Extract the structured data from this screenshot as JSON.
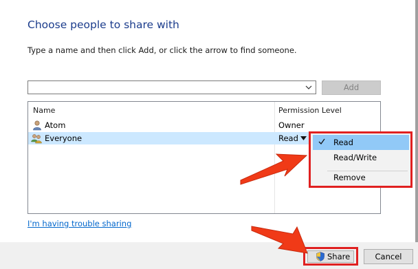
{
  "header": {
    "title": "Choose people to share with",
    "instruction": "Type a name and then click Add, or click the arrow to find someone."
  },
  "name_input": {
    "value": ""
  },
  "add_button": {
    "label": "Add",
    "enabled": false
  },
  "list": {
    "columns": [
      "Name",
      "Permission Level"
    ],
    "rows": [
      {
        "name": "Atom",
        "permission": "Owner",
        "icon": "user-icon",
        "selected": false
      },
      {
        "name": "Everyone",
        "permission": "Read",
        "icon": "users-group-icon",
        "selected": true
      }
    ]
  },
  "permission_menu": {
    "items": [
      {
        "label": "Read",
        "checked": true,
        "highlighted": true
      },
      {
        "label": "Read/Write",
        "checked": false,
        "highlighted": false
      },
      {
        "label": "Remove",
        "checked": false,
        "highlighted": false
      }
    ]
  },
  "trouble_link": "I'm having trouble sharing",
  "footer": {
    "share_label": "Share",
    "cancel_label": "Cancel",
    "share_icon": "uac-shield-icon"
  },
  "annotations": {
    "highlight_color": "#e02020",
    "arrow_color": "#f03a17"
  },
  "colors": {
    "title": "#1b3c8c",
    "selection": "#cce8ff",
    "menu_highlight": "#91c9f7",
    "link": "#0066cc"
  }
}
